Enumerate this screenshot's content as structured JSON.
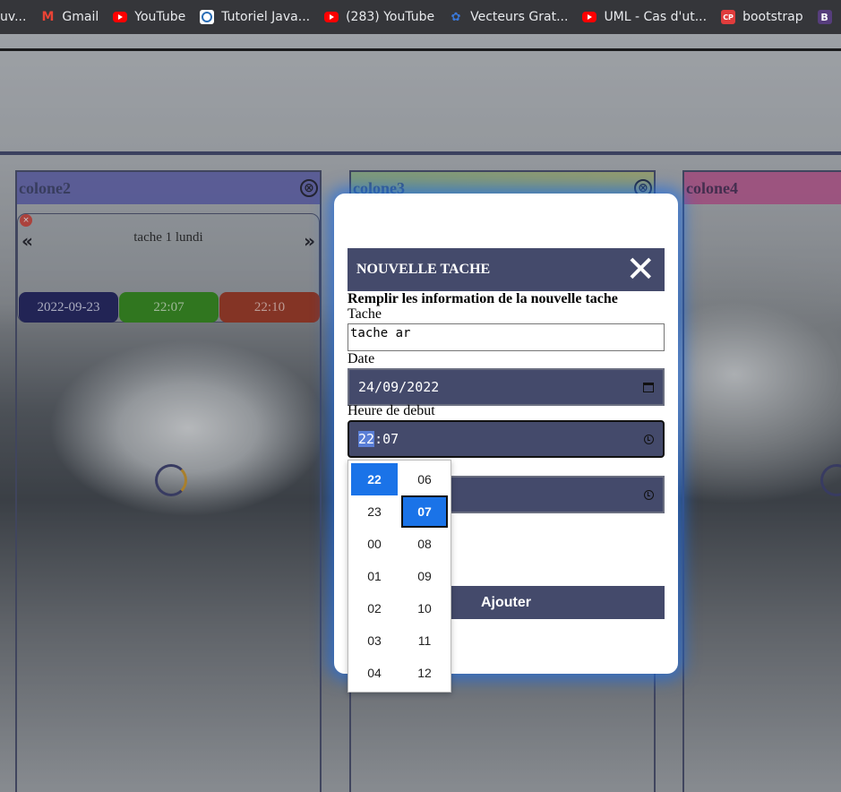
{
  "bookmarks": [
    {
      "label": "uv...",
      "icon": "none"
    },
    {
      "label": "Gmail",
      "icon": "gmail-icon"
    },
    {
      "label": "YouTube",
      "icon": "youtube-icon"
    },
    {
      "label": "Tutoriel Java...",
      "icon": "tutoriel-icon"
    },
    {
      "label": "(283) YouTube",
      "icon": "youtube-icon"
    },
    {
      "label": "Vecteurs Grat...",
      "icon": "vecteurs-icon"
    },
    {
      "label": "UML - Cas d'ut...",
      "icon": "youtube-icon"
    },
    {
      "label": "bootstrap",
      "icon": "codepen-icon"
    },
    {
      "label": "",
      "icon": "bootstrap-icon"
    }
  ],
  "columns": [
    {
      "name": "colone2",
      "color": "#5b5db5",
      "close": "⊗"
    },
    {
      "name": "colone3",
      "color": "#b9c27a",
      "close": "⊗"
    },
    {
      "name": "colone4",
      "color": "#c55593",
      "close": ""
    }
  ],
  "task": {
    "title": "tache 1 lundi",
    "prev": "«",
    "next": "»",
    "delete": "×",
    "date": "2022-09-23",
    "start": "22:07",
    "end": "22:10",
    "colors": {
      "date": "#1b1c5e",
      "start": "#2f8e12",
      "end": "#a3321b"
    }
  },
  "modal": {
    "title": "NOUVELLE TACHE",
    "close": "✕",
    "subtitle": "Remplir les information de la nouvelle tache",
    "task_label": "Tache",
    "task_value": "tache ar",
    "date_label": "Date",
    "date_value": "24/09/2022",
    "start_label": "Heure de debut",
    "start_hour": "22",
    "start_minute": "07",
    "submit": "Ajouter"
  },
  "picker": {
    "hours": [
      "22",
      "23",
      "00",
      "01",
      "02",
      "03",
      "04"
    ],
    "minutes": [
      "06",
      "07",
      "08",
      "09",
      "10",
      "11",
      "12"
    ],
    "selected_hour": "22",
    "selected_minute": "07"
  }
}
